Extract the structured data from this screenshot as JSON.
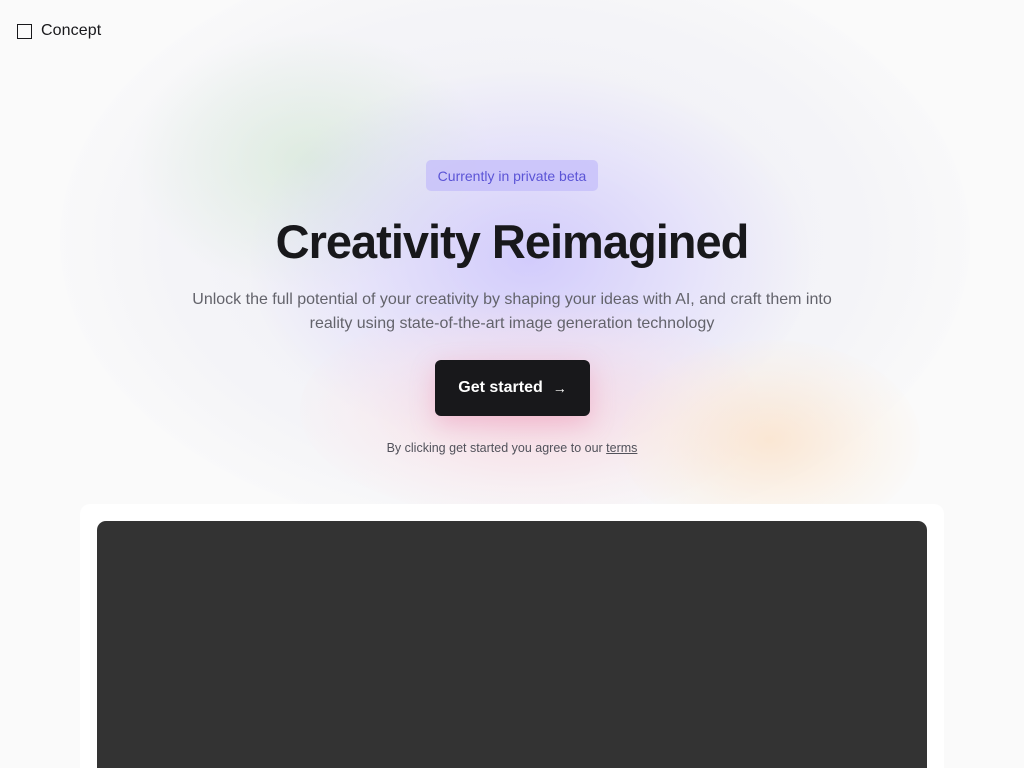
{
  "brand": {
    "name": "Concept",
    "icon": "square-outline-icon"
  },
  "hero": {
    "badge": "Currently in private beta",
    "title": "Creativity Reimagined",
    "subtitle": "Unlock the full potential of your creativity by shaping your ideas with AI, and craft them into reality using state-of-the-art image generation technology",
    "cta_label": "Get started",
    "cta_icon": "arrow-right-icon",
    "cta_arrow": "→",
    "agree_text": "By clicking get started you agree to our",
    "terms_link": "terms"
  },
  "colors": {
    "background": "#fafafa",
    "text": "#18181b",
    "muted": "#63636b",
    "badge_bg": "#c4befa",
    "badge_text": "#5b54d6",
    "button_bg": "#18181b",
    "preview_bg": "#333333"
  }
}
